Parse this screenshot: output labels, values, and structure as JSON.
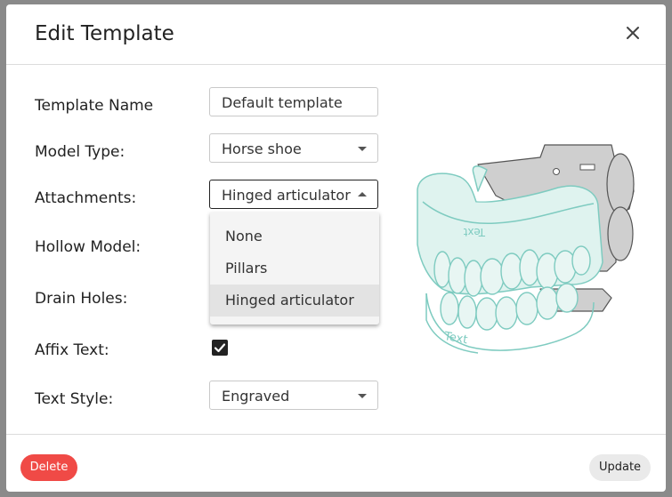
{
  "dialog": {
    "title": "Edit Template"
  },
  "form": {
    "template_name": {
      "label": "Template Name",
      "value": "Default template"
    },
    "model_type": {
      "label": "Model Type:",
      "value": "Horse shoe"
    },
    "attachments": {
      "label": "Attachments:",
      "value": "Hinged articulator",
      "options": [
        "None",
        "Pillars",
        "Hinged articulator"
      ]
    },
    "hollow_model": {
      "label": "Hollow Model:"
    },
    "drain_holes": {
      "label": "Drain Holes:"
    },
    "affix_text": {
      "label": "Affix Text:",
      "checked": true
    },
    "text_style": {
      "label": "Text Style:",
      "value": "Engraved"
    }
  },
  "illustration": {
    "name": "dental model with hinged articulator",
    "engraved_text_top": "Text",
    "engraved_text_bottom": "Text",
    "colors": {
      "teal": "#7ecbc0",
      "teal_fill": "#dff3ef",
      "hinge_gray": "#cfcfcf"
    }
  },
  "footer": {
    "delete_label": "Delete",
    "update_label": "Update"
  },
  "colors": {
    "delete_bg": "#f04a46",
    "overlay": "#8a8a8a"
  }
}
